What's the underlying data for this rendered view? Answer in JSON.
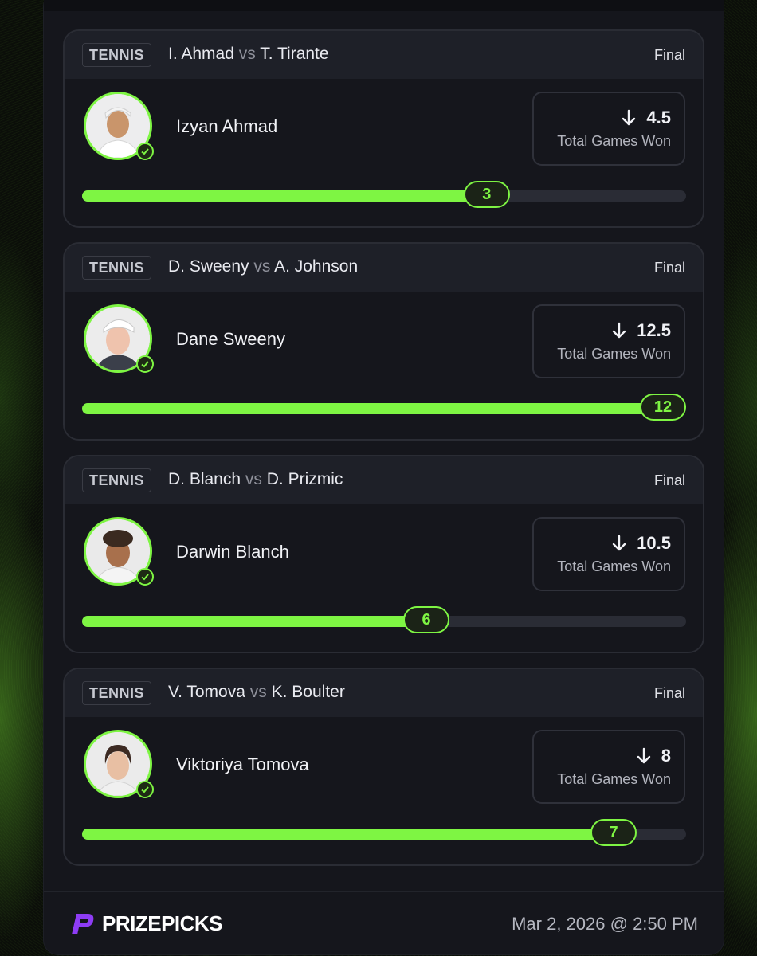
{
  "cards": [
    {
      "sport": "TENNIS",
      "player1": "I. Ahmad",
      "vs": "vs",
      "player2": "T. Tirante",
      "status": "Final",
      "player_name": "Izyan Ahmad",
      "line": "4.5",
      "direction_icon": "arrow-down-icon",
      "stat": "Total Games Won",
      "result": "3",
      "progress": 0.67
    },
    {
      "sport": "TENNIS",
      "player1": "D. Sweeny",
      "vs": "vs",
      "player2": "A. Johnson",
      "status": "Final",
      "player_name": "Dane Sweeny",
      "line": "12.5",
      "direction_icon": "arrow-down-icon",
      "stat": "Total Games Won",
      "result": "12",
      "progress": 1.0
    },
    {
      "sport": "TENNIS",
      "player1": "D. Blanch",
      "vs": "vs",
      "player2": "D. Prizmic",
      "status": "Final",
      "player_name": "Darwin Blanch",
      "line": "10.5",
      "direction_icon": "arrow-down-icon",
      "stat": "Total Games Won",
      "result": "6",
      "progress": 0.57
    },
    {
      "sport": "TENNIS",
      "player1": "V. Tomova",
      "vs": "vs",
      "player2": "K. Boulter",
      "status": "Final",
      "player_name": "Viktoriya Tomova",
      "line": "8",
      "direction_icon": "arrow-down-icon",
      "stat": "Total Games Won",
      "result": "7",
      "progress": 0.88
    }
  ],
  "footer": {
    "brand": "PRIZEPICKS",
    "timestamp": "Mar 2, 2026 @ 2:50 PM"
  },
  "colors": {
    "accent": "#7ef543",
    "panel": "#15161c",
    "card_header": "#1e2028"
  }
}
